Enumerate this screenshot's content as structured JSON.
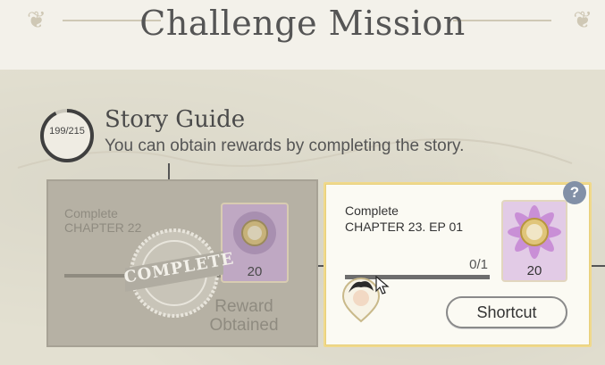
{
  "header": {
    "title": "Challenge Mission"
  },
  "section": {
    "progress_text": "199/215",
    "progress_fraction": 0.9256,
    "title": "Story Guide",
    "subtitle": "You can obtain rewards by completing the story."
  },
  "missions": [
    {
      "status": "completed",
      "label": "Complete",
      "chapter": "CHAPTER 22",
      "reward_count": "20",
      "stamp_text": "COMPLETE",
      "obtained_text": "Reward Obtained"
    },
    {
      "status": "active",
      "label": "Complete",
      "chapter": "CHAPTER 23. EP 01",
      "progress_text": "0/1",
      "reward_count": "20",
      "shortcut_label": "Shortcut",
      "help_label": "?"
    }
  ],
  "colors": {
    "background": "#e3e0d1",
    "card_highlight": "#f0d98b",
    "help_badge": "#8290a7",
    "reward_frame": "#e2cbe6"
  },
  "icons": {
    "ornament": "flourish-icon",
    "reward": "medal-icon",
    "help": "question-icon",
    "avatar": "character-avatar-icon",
    "cursor": "mouse-pointer-icon",
    "stamp": "complete-stamp-icon"
  }
}
